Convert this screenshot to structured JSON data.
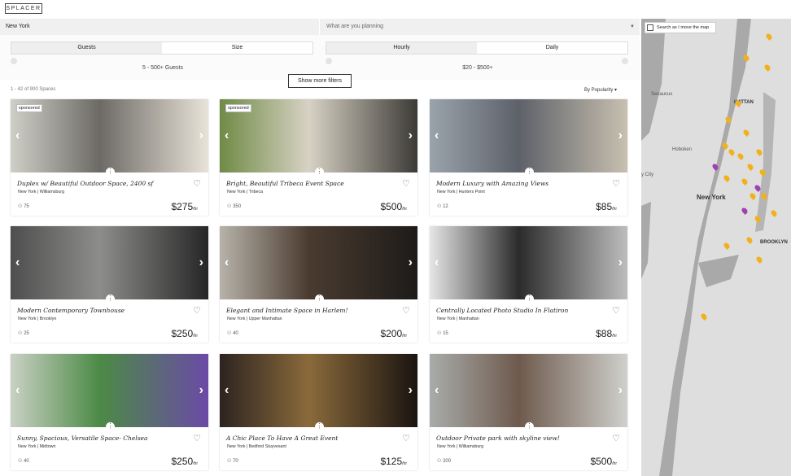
{
  "brand": "SPLACER",
  "search": {
    "location": "New York",
    "planning_placeholder": "What are you planning"
  },
  "filters": {
    "left_tabs": [
      "Guests",
      "Size"
    ],
    "left_range": "5 - 500+ Guests",
    "right_tabs": [
      "Hourly",
      "Daily"
    ],
    "right_range": "$20 - $500+",
    "more_filters": "Show more filters"
  },
  "results": {
    "count": "1 - 42 of 900 Spaces",
    "sort": "By Popularity"
  },
  "map": {
    "search_toggle": "Search as I move the map",
    "labels": [
      "New York",
      "BROOKLYN",
      "HATTAN",
      "Hoboken",
      "Secaucus",
      "y City"
    ]
  },
  "listings": [
    {
      "sponsored": "sponsored",
      "title": "Duplex w/ Beautiful Outdoor Space, 2400 sf",
      "city": "New York | Williamsburg",
      "guests": "75",
      "price": "$275",
      "unit": "/hr",
      "colors": [
        "#cfcfc7",
        "#6d6a66",
        "#e8e3d8"
      ]
    },
    {
      "sponsored": "sponsored",
      "title": "Bright, Beautiful Tribeca Event Space",
      "city": "New York | Tribeca",
      "guests": "350",
      "price": "$500",
      "unit": "/hr",
      "colors": [
        "#6f8a45",
        "#d7d2c4",
        "#3c3a36"
      ]
    },
    {
      "sponsored": "",
      "title": "Modern Luxury with Amazing Views",
      "city": "New York | Hunters Point",
      "guests": "12",
      "price": "$85",
      "unit": "/hr",
      "colors": [
        "#9aa3ab",
        "#5d6169",
        "#c8c0b0"
      ]
    },
    {
      "sponsored": "",
      "title": "Modern Contemporary Townhouse",
      "city": "New York | Brooklyn",
      "guests": "25",
      "price": "$250",
      "unit": "/hr",
      "colors": [
        "#4e4e4e",
        "#8d8d8b",
        "#262626"
      ]
    },
    {
      "sponsored": "",
      "title": "Elegant and Intimate Space in Harlem!",
      "city": "New York | Upper Manhattan",
      "guests": "40",
      "price": "$200",
      "unit": "/hr",
      "colors": [
        "#b7b3aa",
        "#4a3b30",
        "#1d1b19"
      ]
    },
    {
      "sponsored": "",
      "title": "Centrally Located Photo Studio In Flatiron",
      "city": "New York | Manhattan",
      "guests": "15",
      "price": "$88",
      "unit": "/hr",
      "colors": [
        "#e6e6e6",
        "#2b2b2b",
        "#bdbdbd"
      ]
    },
    {
      "sponsored": "",
      "title": "Sunny, Spacious, Versatile Space- Chelsea",
      "city": "New York | Midtown",
      "guests": "40",
      "price": "$250",
      "unit": "/hr",
      "colors": [
        "#c9d1c4",
        "#4c8a46",
        "#6b4aa6"
      ]
    },
    {
      "sponsored": "",
      "title": "A Chic Place To Have A Great Event",
      "city": "New York | Bedford Stuyvesant",
      "guests": "70",
      "price": "$125",
      "unit": "/hr",
      "colors": [
        "#2d2420",
        "#8a6a3b",
        "#1a1410"
      ]
    },
    {
      "sponsored": "",
      "title": "Outdoor Private park with skyline view!",
      "city": "New York | Williamsburg",
      "guests": "200",
      "price": "$500",
      "unit": "/hr",
      "colors": [
        "#a8acaa",
        "#6e5a4d",
        "#cfd0cc"
      ]
    }
  ]
}
